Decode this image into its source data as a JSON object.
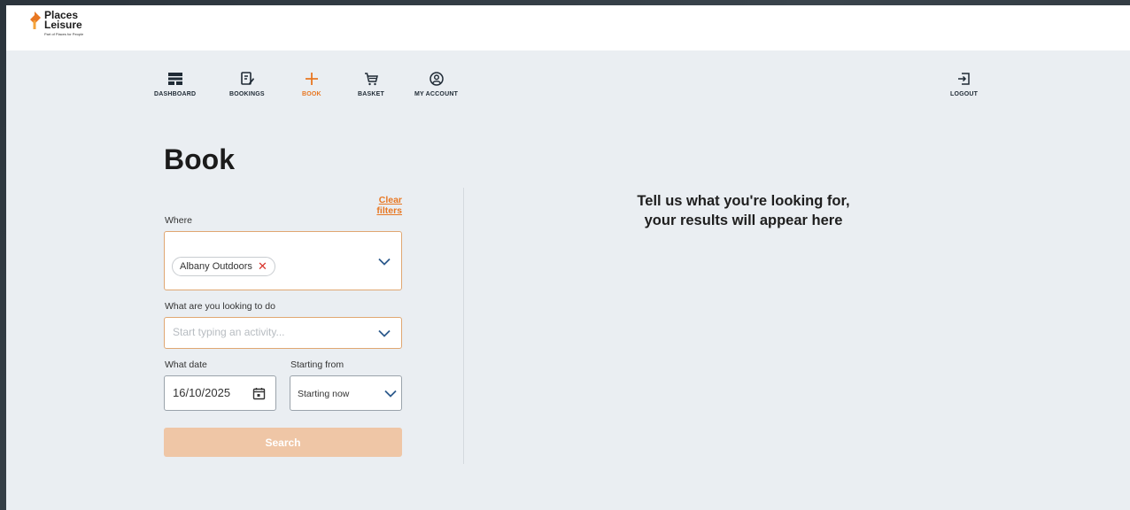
{
  "brand": {
    "line1": "Places",
    "line2": "Leisure",
    "tagline": "Part of Places for People",
    "accent": "#e87722"
  },
  "nav": {
    "dashboard": "DASHBOARD",
    "bookings": "BOOKINGS",
    "book": "BOOK",
    "basket": "BASKET",
    "account": "MY ACCOUNT",
    "logout": "LOGOUT",
    "active": "book"
  },
  "page": {
    "title": "Book"
  },
  "filters": {
    "clear_label": "Clear filters",
    "where_label": "Where",
    "where_chip": "Albany Outdoors",
    "activity_label": "What are you looking to do",
    "activity_placeholder": "Start typing an activity...",
    "date_label": "What date",
    "date_value": "16/10/2025",
    "start_label": "Starting from",
    "start_value": "Starting now",
    "search_label": "Search"
  },
  "results": {
    "line1": "Tell us what you're looking for,",
    "line2": "your results will appear here"
  },
  "icons": {
    "dashboard": "dashboard-icon",
    "bookings": "bookings-icon",
    "book": "plus-icon",
    "basket": "basket-icon",
    "account": "account-icon",
    "logout": "logout-icon",
    "chevron": "chevron-down-icon",
    "calendar": "calendar-icon",
    "remove": "close-icon"
  }
}
